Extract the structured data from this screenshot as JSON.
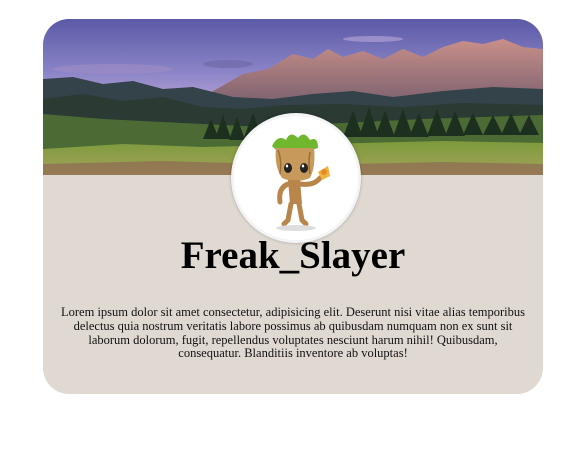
{
  "profile": {
    "username": "Freak_Slayer",
    "bio": "Lorem ipsum dolor sit amet consectetur, adipisicing elit. Deserunt nisi vitae alias temporibus delectus quia nostrum veritatis labore possimus ab quibusdam numquam non ex sunt sit laborum dolorum, fugit, repellendus voluptates nesciunt harum nihil! Quibusdam, consequatur. Blanditiis inventore ab voluptas!",
    "banner_image": "mountain-landscape-image",
    "avatar_image": "groot-figure-avatar"
  },
  "colors": {
    "card_background": "#e0d9d2",
    "page_background": "#ffffff"
  }
}
